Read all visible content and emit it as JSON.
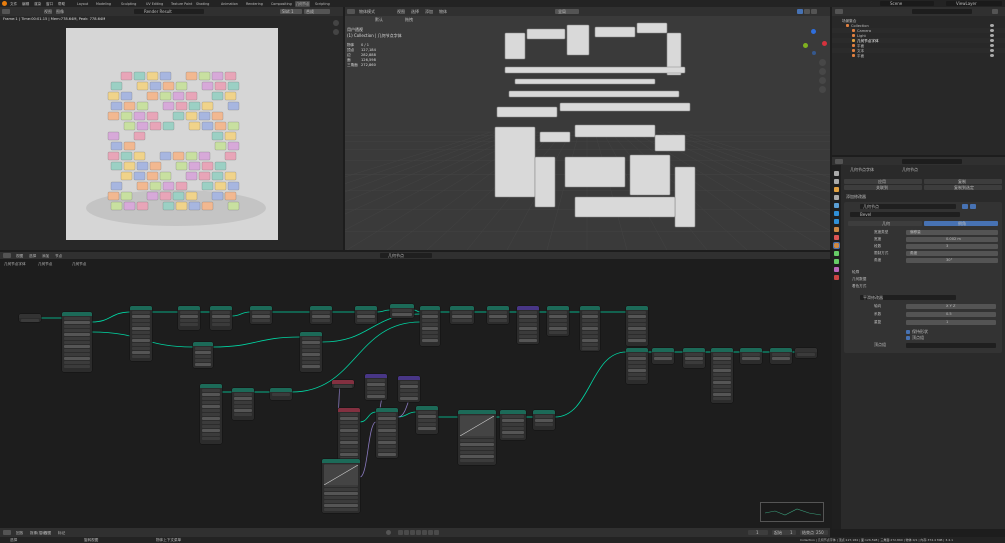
{
  "top_menu": {
    "items": [
      "文件",
      "编辑",
      "渲染",
      "窗口",
      "帮助"
    ],
    "workspaces": [
      "Layout",
      "Modeling",
      "Sculpting",
      "UV Editing",
      "Texture Paint",
      "Shading",
      "Animation",
      "Rendering",
      "Compositing",
      "几何节点",
      "Scripting"
    ],
    "scene": "Scene",
    "view_layer": "ViewLayer"
  },
  "image_editor": {
    "header_view": "视图",
    "header_image": "图像",
    "render_slot": "Render Result",
    "slot": "Slot 1",
    "layer": "合成",
    "status": "Frame:1 | Time:00:01.15 | Mem:778.64M, Peak: 778.64M"
  },
  "viewport": {
    "menus": [
      "物体模式",
      "视图",
      "选择",
      "添加",
      "物体"
    ],
    "orientation": "全局",
    "pivot": "默认",
    "drag": "拖拽",
    "overlay_title": "用户透视",
    "overlay_collection": "(1) Collection | 几何节点字体",
    "stats": [
      {
        "label": "物体",
        "value": "0 / 1"
      },
      {
        "label": "顶点",
        "value": "127,184"
      },
      {
        "label": "边",
        "value": "282,888"
      },
      {
        "label": "面",
        "value": "126,598"
      },
      {
        "label": "三角面",
        "value": "272,860"
      }
    ]
  },
  "outliner": {
    "title": "场景集合",
    "items": [
      {
        "label": "Collection",
        "level": 1
      },
      {
        "label": "Camera",
        "level": 2
      },
      {
        "label": "Light",
        "level": 2
      },
      {
        "label": "几何节点字体",
        "level": 2
      },
      {
        "label": "平面",
        "level": 2
      },
      {
        "label": "文本",
        "level": 2
      },
      {
        "label": "平面",
        "level": 2
      }
    ]
  },
  "properties": {
    "object": "几何节点字体",
    "modifier_tab": "几何节点",
    "buttons": [
      "应用",
      "复制",
      "关联到",
      "复制到选定"
    ],
    "add_modifier": "添加修改器",
    "modifier_name": "几何节点",
    "nodegroup": "Bevel",
    "tabs": [
      "几何",
      "倒角"
    ],
    "fields": [
      {
        "label": "宽度类型",
        "value": "偏移量"
      },
      {
        "label": "宽度",
        "value": "0.002 m"
      },
      {
        "label": "段数",
        "value": "3"
      },
      {
        "label": "限制方式",
        "value": "角度"
      },
      {
        "label": "角度",
        "value": "30°"
      }
    ],
    "sections": [
      "轮廓",
      "几何数据",
      "着色方式"
    ],
    "smooth_name": "平滑修改器",
    "smooth_fields": [
      {
        "label": "轴向",
        "value": "X Y Z"
      },
      {
        "label": "系数",
        "value": "0.5"
      },
      {
        "label": "重复",
        "value": "1"
      }
    ],
    "checkbox1": "保持形状",
    "checkbox2": "顶点组",
    "vertex_group": "顶点组"
  },
  "node_editor": {
    "menus": [
      "视图",
      "选择",
      "添加",
      "节点"
    ],
    "tree_name": "几何节点",
    "breadcrumb": [
      "几何节点字体",
      "几何节点",
      "几何节点"
    ],
    "bottom_info": "转换 / 平移视图"
  },
  "timeline": {
    "menus": [
      "回放",
      "抠像(插帧)",
      "视图",
      "标记"
    ],
    "frame_current": "1",
    "start_label": "起始",
    "start": "1",
    "end_label": "结束点",
    "end": "250"
  },
  "status_bar": {
    "left": "选择",
    "mid": "旋转视图",
    "mid2": "物体上下文菜单",
    "right": "Collection | 几何节点字体 | 顶点:127,184 | 面:126,598 | 三角面:272,860 | 物体:0/1 | 内存:374.4 MiB | 3.4.1"
  },
  "colors": {
    "accent": "#4772b3",
    "geometry": "#00d6a3",
    "header_teal": "#1c6a58",
    "header_red": "#833040",
    "header_purple": "#483686",
    "header_dark": "#333333"
  }
}
